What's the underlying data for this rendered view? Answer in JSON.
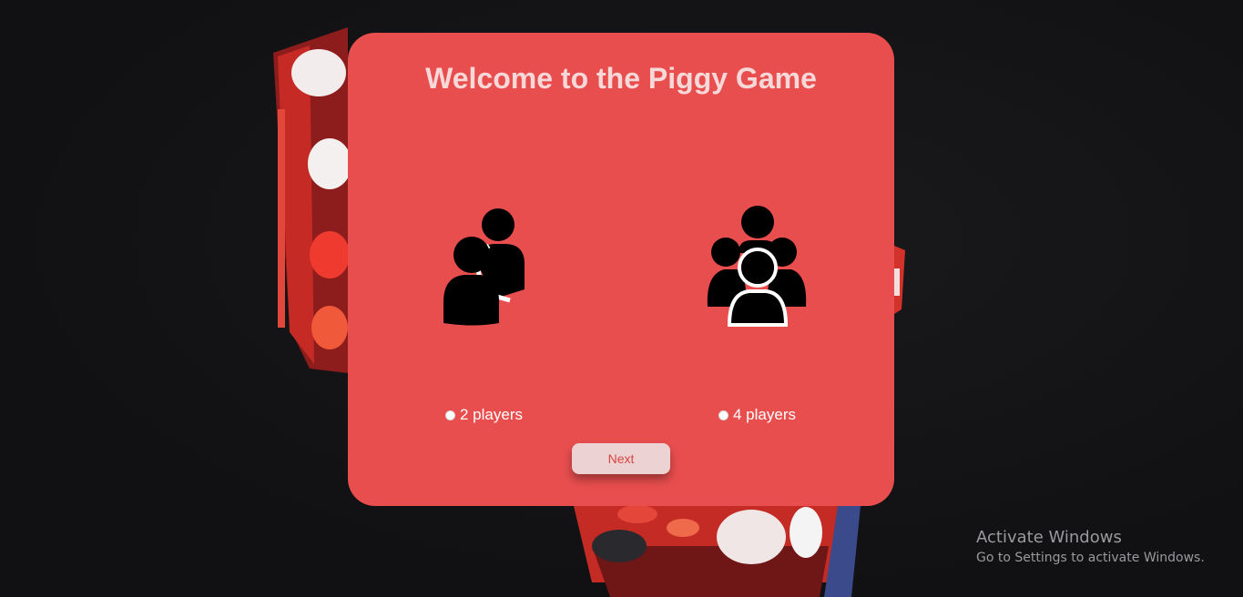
{
  "game": {
    "title": "Welcome to the Piggy Game",
    "options": [
      {
        "label": "2 players",
        "icon": "two-users-icon",
        "selected": false
      },
      {
        "label": "4 players",
        "icon": "four-users-icon",
        "selected": false
      }
    ],
    "next_label": "Next"
  },
  "watermark": {
    "title": "Activate Windows",
    "subtitle": "Go to Settings to activate Windows."
  },
  "colors": {
    "card": "#e94e4e",
    "title": "#f6d8d8",
    "button_bg": "#ecd2d2",
    "button_text": "#d64545",
    "background": "#141416"
  }
}
